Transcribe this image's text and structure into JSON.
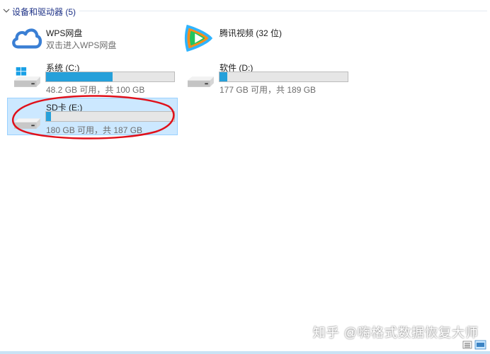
{
  "group": {
    "title": "设备和驱动器 (5)"
  },
  "items": {
    "wps": {
      "name": "WPS网盘",
      "sub": "双击进入WPS网盘"
    },
    "tencent": {
      "name": "腾讯视频 (32 位)"
    },
    "c": {
      "name": "系统 (C:)",
      "sub": "48.2 GB 可用，共 100 GB",
      "used_fraction": 0.518
    },
    "d": {
      "name": "软件 (D:)",
      "sub": "177 GB 可用，共 189 GB",
      "used_fraction": 0.063
    },
    "e": {
      "name": "SD卡 (E:)",
      "sub": "180 GB 可用，共 187 GB",
      "used_fraction": 0.037
    }
  },
  "watermark": "知乎 @嗨格式数据恢复大师",
  "colors": {
    "accent": "#26a0da",
    "selection": "#cce8ff",
    "annotation": "#e0101a",
    "group_title": "#1e3287"
  },
  "icons": {
    "wps": "cloud-icon",
    "tencent": "tencent-video-icon",
    "c": "system-drive-icon",
    "d": "drive-icon",
    "e": "removable-drive-icon"
  }
}
